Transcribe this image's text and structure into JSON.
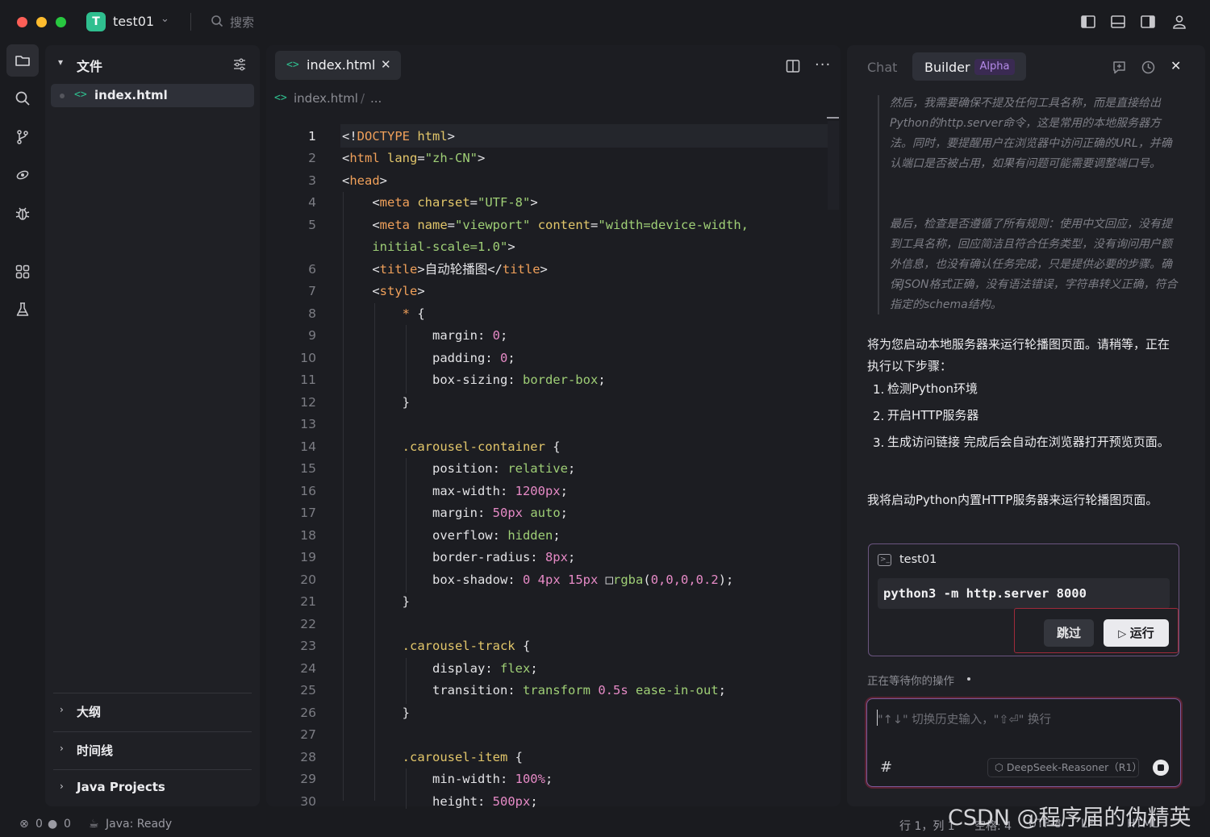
{
  "titlebar": {
    "project_badge": "T",
    "project_name": "test01",
    "search_label": "搜索"
  },
  "explorer": {
    "title": "文件",
    "file_name": "index.html",
    "sections": [
      {
        "label": "大纲"
      },
      {
        "label": "时间线"
      },
      {
        "label": "Java Projects"
      }
    ]
  },
  "editor": {
    "tab_name": "index.html",
    "breadcrumb_file": "index.html",
    "breadcrumb_sep": "/",
    "breadcrumb_more": "...",
    "line_numbers": [
      "1",
      "2",
      "3",
      "4",
      "5",
      "6",
      "7",
      "8",
      "9",
      "10",
      "11",
      "12",
      "13",
      "14",
      "15",
      "16",
      "17",
      "18",
      "19",
      "20",
      "21",
      "22",
      "23",
      "24",
      "25",
      "26",
      "27",
      "28",
      "29",
      "30"
    ]
  },
  "code_lines": [
    [
      [
        "t-punc",
        "<!"
      ],
      [
        "t-tag",
        "DOCTYPE"
      ],
      [
        "t-punc",
        " "
      ],
      [
        "t-attr",
        "html"
      ],
      [
        "t-punc",
        ">"
      ]
    ],
    [
      [
        "t-punc",
        "<"
      ],
      [
        "t-tag",
        "html"
      ],
      [
        "t-punc",
        " "
      ],
      [
        "t-attr",
        "lang"
      ],
      [
        "t-punc",
        "="
      ],
      [
        "t-str",
        "\"zh-CN\""
      ],
      [
        "t-punc",
        ">"
      ]
    ],
    [
      [
        "t-punc",
        "<"
      ],
      [
        "t-tag",
        "head"
      ],
      [
        "t-punc",
        ">"
      ]
    ],
    [
      [
        "t-punc",
        "    <"
      ],
      [
        "t-tag",
        "meta"
      ],
      [
        "t-punc",
        " "
      ],
      [
        "t-attr",
        "charset"
      ],
      [
        "t-punc",
        "="
      ],
      [
        "t-str",
        "\"UTF-8\""
      ],
      [
        "t-punc",
        ">"
      ]
    ],
    [
      [
        "t-punc",
        "    <"
      ],
      [
        "t-tag",
        "meta"
      ],
      [
        "t-punc",
        " "
      ],
      [
        "t-attr",
        "name"
      ],
      [
        "t-punc",
        "="
      ],
      [
        "t-str",
        "\"viewport\""
      ],
      [
        "t-punc",
        " "
      ],
      [
        "t-attr",
        "content"
      ],
      [
        "t-punc",
        "="
      ],
      [
        "t-str",
        "\"width=device-width,"
      ]
    ],
    [
      [
        "t-str",
        "    initial-scale=1.0\""
      ],
      [
        "t-punc",
        ">"
      ]
    ],
    [
      [
        "t-punc",
        "    <"
      ],
      [
        "t-tag",
        "title"
      ],
      [
        "t-punc",
        ">"
      ],
      [
        "t-text",
        "自动轮播图"
      ],
      [
        "t-punc",
        "</"
      ],
      [
        "t-tag",
        "title"
      ],
      [
        "t-punc",
        ">"
      ]
    ],
    [
      [
        "t-punc",
        "    <"
      ],
      [
        "t-tag",
        "style"
      ],
      [
        "t-punc",
        ">"
      ]
    ],
    [
      [
        "t-star",
        "        * "
      ],
      [
        "t-punc",
        "{"
      ]
    ],
    [
      [
        "t-prop",
        "            margin"
      ],
      [
        "t-punc",
        ": "
      ],
      [
        "t-num",
        "0"
      ],
      [
        "t-punc",
        ";"
      ]
    ],
    [
      [
        "t-prop",
        "            padding"
      ],
      [
        "t-punc",
        ": "
      ],
      [
        "t-num",
        "0"
      ],
      [
        "t-punc",
        ";"
      ]
    ],
    [
      [
        "t-prop",
        "            box-sizing"
      ],
      [
        "t-punc",
        ": "
      ],
      [
        "t-val",
        "border-box"
      ],
      [
        "t-punc",
        ";"
      ]
    ],
    [
      [
        "t-punc",
        "        }"
      ]
    ],
    [
      [
        "t-punc",
        ""
      ]
    ],
    [
      [
        "t-sel",
        "        .carousel-container"
      ],
      [
        "t-punc",
        " {"
      ]
    ],
    [
      [
        "t-prop",
        "            position"
      ],
      [
        "t-punc",
        ": "
      ],
      [
        "t-val",
        "relative"
      ],
      [
        "t-punc",
        ";"
      ]
    ],
    [
      [
        "t-prop",
        "            max-width"
      ],
      [
        "t-punc",
        ": "
      ],
      [
        "t-num",
        "1200px"
      ],
      [
        "t-punc",
        ";"
      ]
    ],
    [
      [
        "t-prop",
        "            margin"
      ],
      [
        "t-punc",
        ": "
      ],
      [
        "t-num",
        "50px"
      ],
      [
        "t-punc",
        " "
      ],
      [
        "t-val",
        "auto"
      ],
      [
        "t-punc",
        ";"
      ]
    ],
    [
      [
        "t-prop",
        "            overflow"
      ],
      [
        "t-punc",
        ": "
      ],
      [
        "t-val",
        "hidden"
      ],
      [
        "t-punc",
        ";"
      ]
    ],
    [
      [
        "t-prop",
        "            border-radius"
      ],
      [
        "t-punc",
        ": "
      ],
      [
        "t-num",
        "8px"
      ],
      [
        "t-punc",
        ";"
      ]
    ],
    [
      [
        "t-prop",
        "            box-shadow"
      ],
      [
        "t-punc",
        ": "
      ],
      [
        "t-num",
        "0"
      ],
      [
        "t-punc",
        " "
      ],
      [
        "t-num",
        "4px"
      ],
      [
        "t-punc",
        " "
      ],
      [
        "t-num",
        "15px"
      ],
      [
        "t-punc",
        " □"
      ],
      [
        "t-val",
        "rgba"
      ],
      [
        "t-punc",
        "("
      ],
      [
        "t-num",
        "0,0,0,0.2"
      ],
      [
        "t-punc",
        ");"
      ]
    ],
    [
      [
        "t-punc",
        "        }"
      ]
    ],
    [
      [
        "t-punc",
        ""
      ]
    ],
    [
      [
        "t-sel",
        "        .carousel-track"
      ],
      [
        "t-punc",
        " {"
      ]
    ],
    [
      [
        "t-prop",
        "            display"
      ],
      [
        "t-punc",
        ": "
      ],
      [
        "t-val",
        "flex"
      ],
      [
        "t-punc",
        ";"
      ]
    ],
    [
      [
        "t-prop",
        "            transition"
      ],
      [
        "t-punc",
        ": "
      ],
      [
        "t-val",
        "transform"
      ],
      [
        "t-punc",
        " "
      ],
      [
        "t-num",
        "0.5s"
      ],
      [
        "t-punc",
        " "
      ],
      [
        "t-val",
        "ease-in-out"
      ],
      [
        "t-punc",
        ";"
      ]
    ],
    [
      [
        "t-punc",
        "        }"
      ]
    ],
    [
      [
        "t-punc",
        ""
      ]
    ],
    [
      [
        "t-sel",
        "        .carousel-item"
      ],
      [
        "t-punc",
        " {"
      ]
    ],
    [
      [
        "t-prop",
        "            min-width"
      ],
      [
        "t-punc",
        ": "
      ],
      [
        "t-num",
        "100%"
      ],
      [
        "t-punc",
        ";"
      ]
    ],
    [
      [
        "t-prop",
        "            height"
      ],
      [
        "t-punc",
        ": "
      ],
      [
        "t-num",
        "500px"
      ],
      [
        "t-punc",
        ";"
      ]
    ]
  ],
  "right_panel": {
    "tab_chat": "Chat",
    "tab_builder": "Builder",
    "builder_badge": "Alpha",
    "thinking_1": "然后，我需要确保不提及任何工具名称，而是直接给出Python的http.server命令，这是常用的本地服务器方法。同时，要提醒用户在浏览器中访问正确的URL，并确认端口是否被占用，如果有问题可能需要调整端口号。",
    "thinking_2": "最后，检查是否遵循了所有规则：使用中文回应，没有提到工具名称，回应简洁且符合任务类型，没有询问用户额外信息，也没有确认任务完成，只是提供必要的步骤。确保JSON格式正确，没有语法错误，字符串转义正确，符合指定的schema结构。",
    "message_1": "将为您启动本地服务器来运行轮播图页面。请稍等，正在执行以下步骤：",
    "steps": [
      {
        "num": "1.",
        "text": "检测Python环境"
      },
      {
        "num": "2.",
        "text": "开启HTTP服务器"
      },
      {
        "num": "3.",
        "text": "生成访问链接 完成后会自动在浏览器打开预览页面。"
      }
    ],
    "message_2": "我将启动Python内置HTTP服务器来运行轮播图页面。",
    "terminal": {
      "title": "test01",
      "command": "python3 -m http.server 8000",
      "skip_label": "跳过",
      "run_label": "运行"
    },
    "waiting_label": "正在等待你的操作",
    "input_placeholder": "\"↑↓\" 切换历史输入，\"⇧⏎\" 换行",
    "input_prefix": "#",
    "model_label": "DeepSeek-Reasoner（R1）"
  },
  "statusbar": {
    "errors": "0",
    "warnings": "0",
    "java_status": "Java: Ready",
    "position": "行 1，列 1",
    "indent": "空格: 4",
    "encoding": "UTF-8",
    "eol": "LF",
    "language": "HTML"
  },
  "watermark": "CSDN @程序届的伪精英",
  "colors": {
    "accent_green": "#2fbf8f",
    "alpha_purple": "#b58be8",
    "highlight_red": "#a02a3a"
  }
}
